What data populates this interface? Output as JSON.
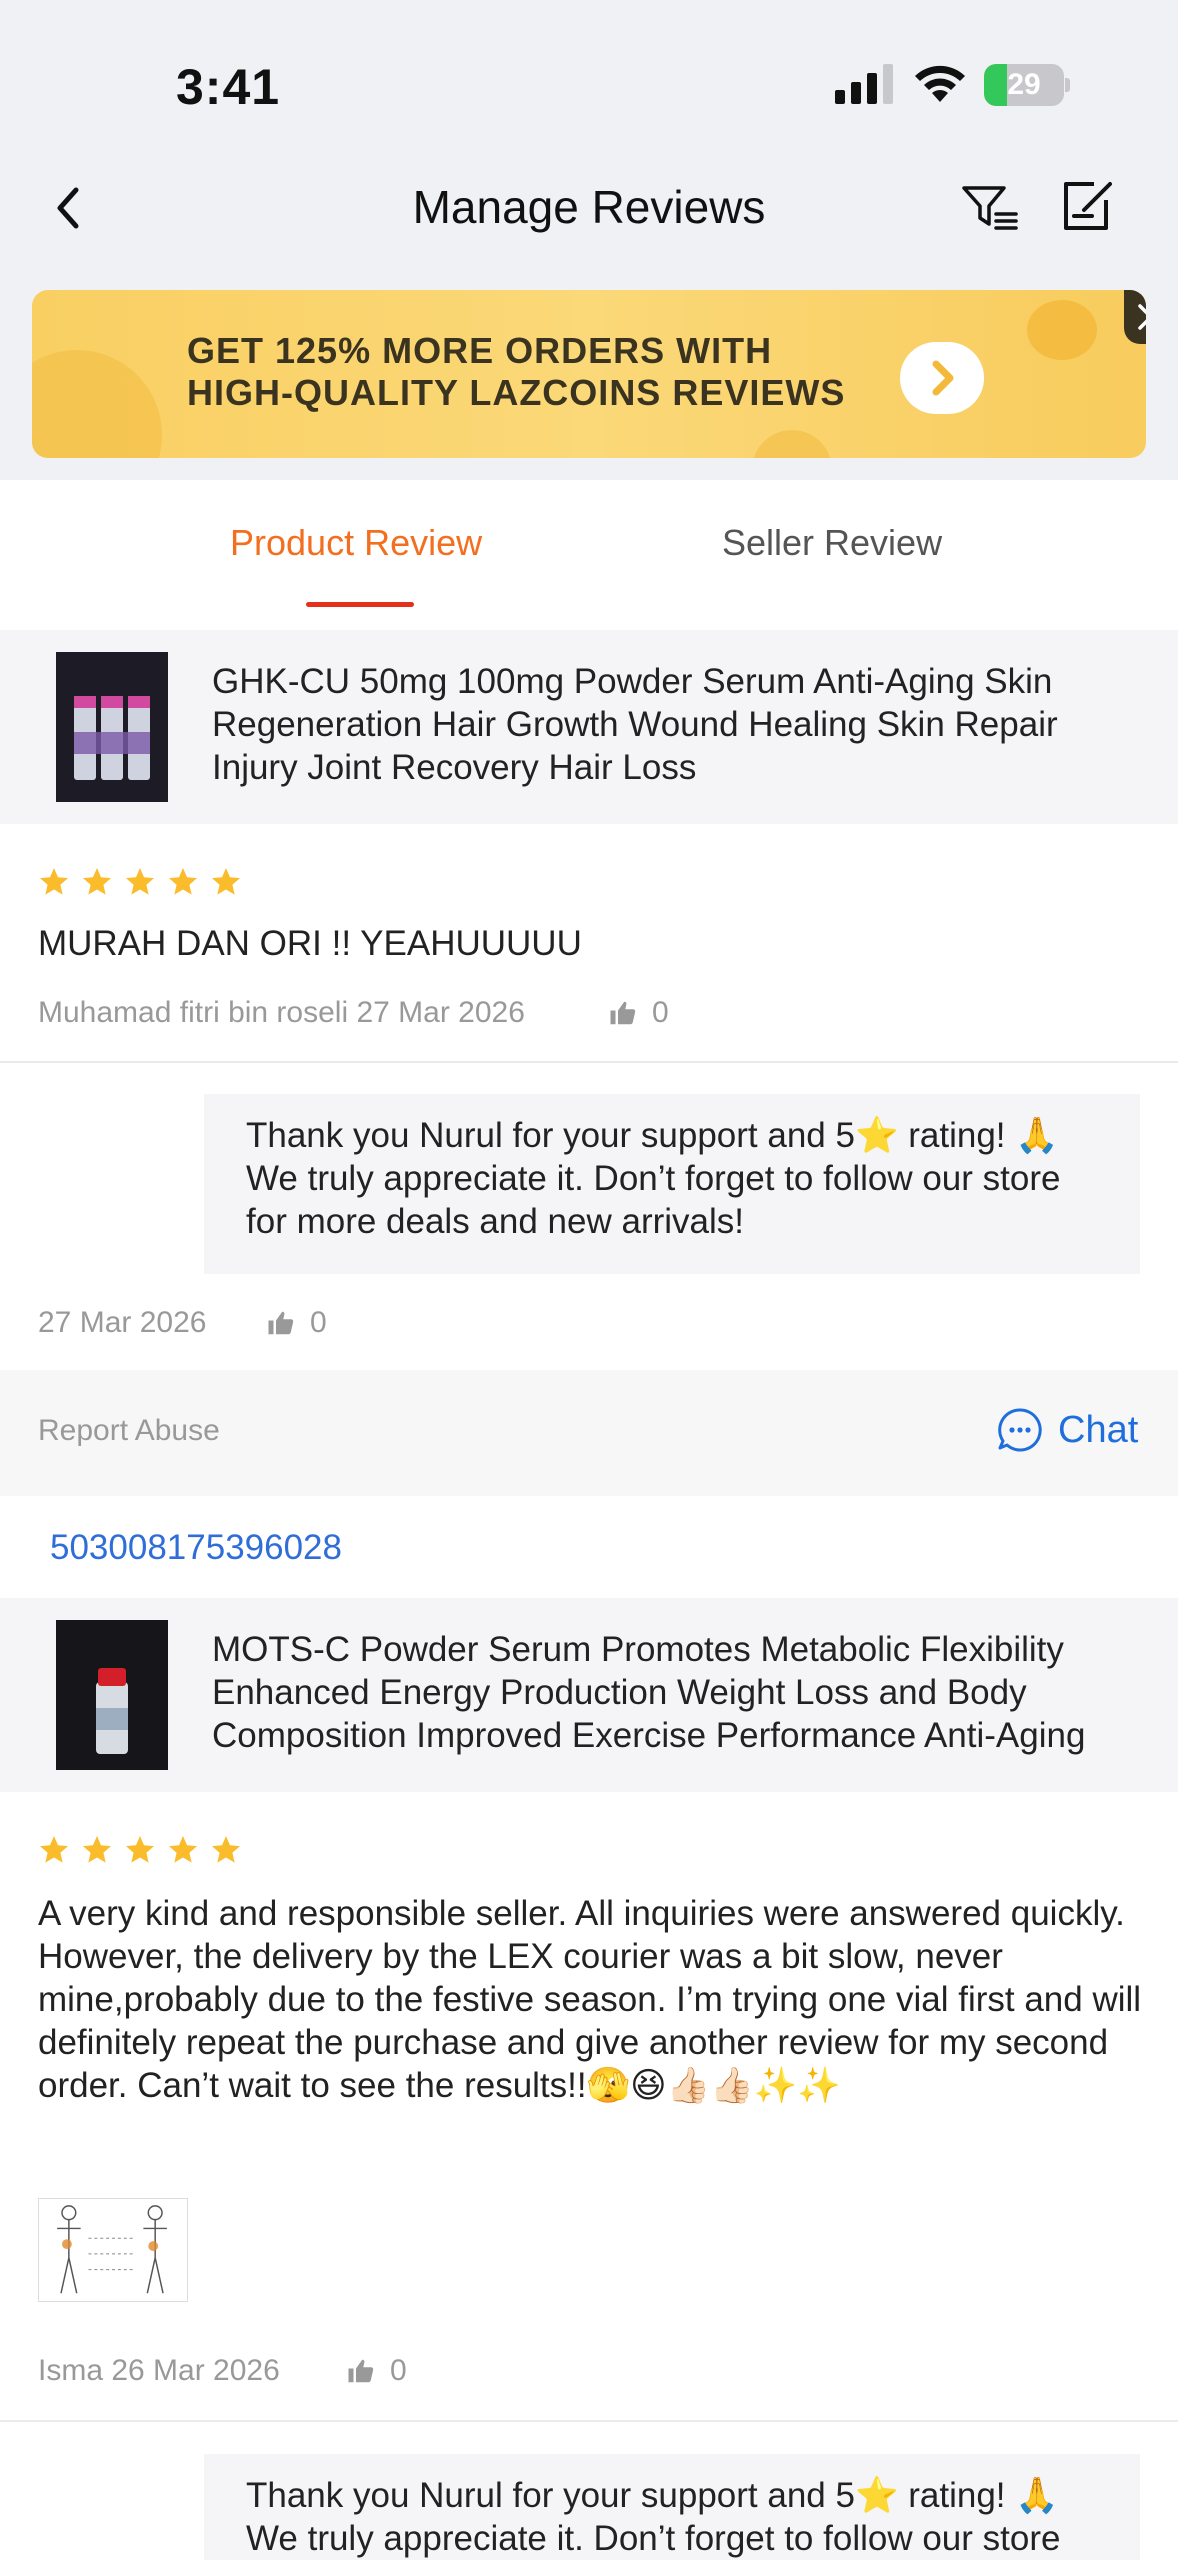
{
  "status_bar": {
    "time": "3:41",
    "battery": "29",
    "battery_level": 0.29
  },
  "nav": {
    "title": "Manage Reviews"
  },
  "banner": {
    "line1": "GET 125% MORE ORDERS WITH",
    "line2": "HIGH-QUALITY LAZCOINS REVIEWS"
  },
  "tabs": [
    {
      "label": "Product Review",
      "active": true
    },
    {
      "label": "Seller Review",
      "active": false
    }
  ],
  "colors": {
    "accent": "#f36f1f",
    "underline": "#e6301e",
    "link": "#2f6ed8",
    "star": "#fbbc2c",
    "banner": "#f9cf62"
  },
  "reviews": [
    {
      "product_title": "GHK-CU 50mg 100mg Powder Serum Anti-Aging Skin Regeneration Hair Growth Wound Healing Skin Repair Injury Joint Recovery Hair Loss",
      "rating": 5,
      "text": "MURAH DAN ORI !! YEAHUUUUU",
      "author_date": "Muhamad fitri bin roseli 27 Mar 2026",
      "likes": "0",
      "reply": {
        "text": "Thank you Nurul for your support and 5⭐️ rating! 🙏 We truly appreciate it. Don’t forget to follow our store for more deals and new arrivals!",
        "date": "27 Mar 2026",
        "likes": "0"
      },
      "actions": {
        "report": "Report Abuse",
        "chat": "Chat"
      }
    },
    {
      "order_id": "503008175396028",
      "product_title": "MOTS-C Powder Serum Promotes Metabolic Flexibility Enhanced Energy Production Weight Loss and Body Composition Improved Exercise Performance Anti-Aging",
      "rating": 5,
      "text": "A very kind and responsible seller. All inquiries were answered quickly. However, the delivery by the LEX courier was a bit slow, never mine,probably due to the festive season. I’m trying one vial first and will definitely repeat the purchase and give another review for my second order. Can’t wait to see the results!!🫣😆👍🏻👍🏻✨✨",
      "author_date": "Isma 26 Mar 2026",
      "likes": "0",
      "reply": {
        "text": "Thank you Nurul for your support and 5⭐️ rating! 🙏 We truly appreciate it. Don’t forget to follow our store for more deals and new arrivals!"
      }
    }
  ]
}
